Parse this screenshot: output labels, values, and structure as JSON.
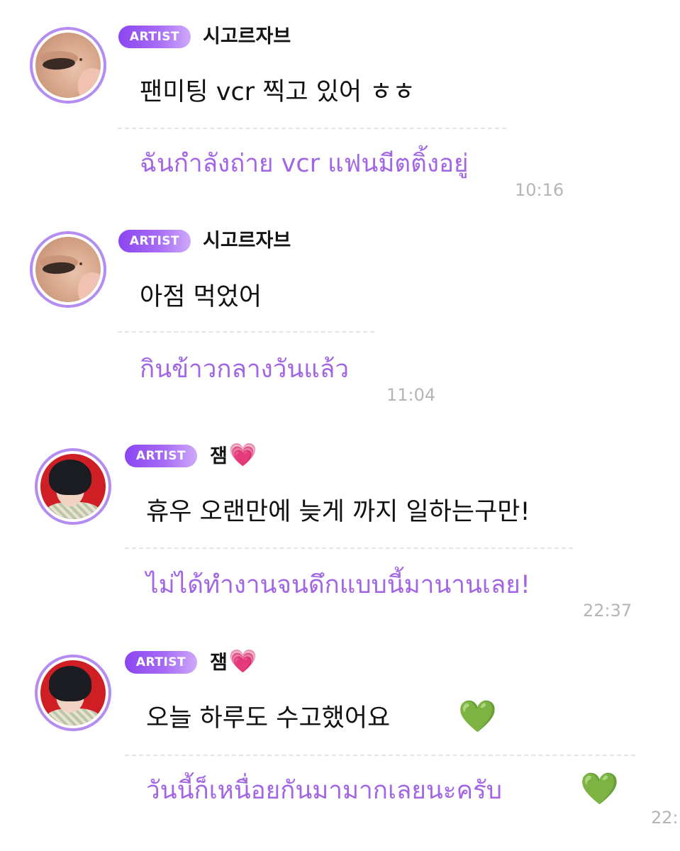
{
  "messages": [
    {
      "badge": "ARTIST",
      "sender": "시고르자브",
      "sender_emoji": "",
      "text": "팬미팅 vcr 찍고 있어 ㅎㅎ",
      "translation": "ฉันกำลังถ่าย vcr แฟนมีตติ้งอยู่",
      "time": "10:16"
    },
    {
      "badge": "ARTIST",
      "sender": "시고르자브",
      "sender_emoji": "",
      "text": "아점 먹었어",
      "translation": "กินข้าวกลางวันแล้ว",
      "time": "11:04"
    },
    {
      "badge": "ARTIST",
      "sender": "잼",
      "sender_emoji": "💗",
      "text": "휴우 오랜만에 늦게 까지 일하는구만!",
      "translation": "ไม่ได้ทำงานจนดึกแบบนี้มานานเลย!",
      "time": "22:37"
    },
    {
      "badge": "ARTIST",
      "sender": "잼",
      "sender_emoji": "💗",
      "text": "오늘 하루도 수고했어요",
      "text_emoji": "💚",
      "translation": "วันนี้ก็เหนื่อยกันมามากเลยนะครับ",
      "translation_emoji": "💚",
      "time": "22:"
    }
  ],
  "colors": {
    "badge_gradient_start": "#8a45f2",
    "avatar_ring": "#b58cf0",
    "translation_text": "#a165e6",
    "timestamp": "#b5b5b5",
    "heart_green": "#1fba28",
    "heart_pink": "#e8338a"
  }
}
